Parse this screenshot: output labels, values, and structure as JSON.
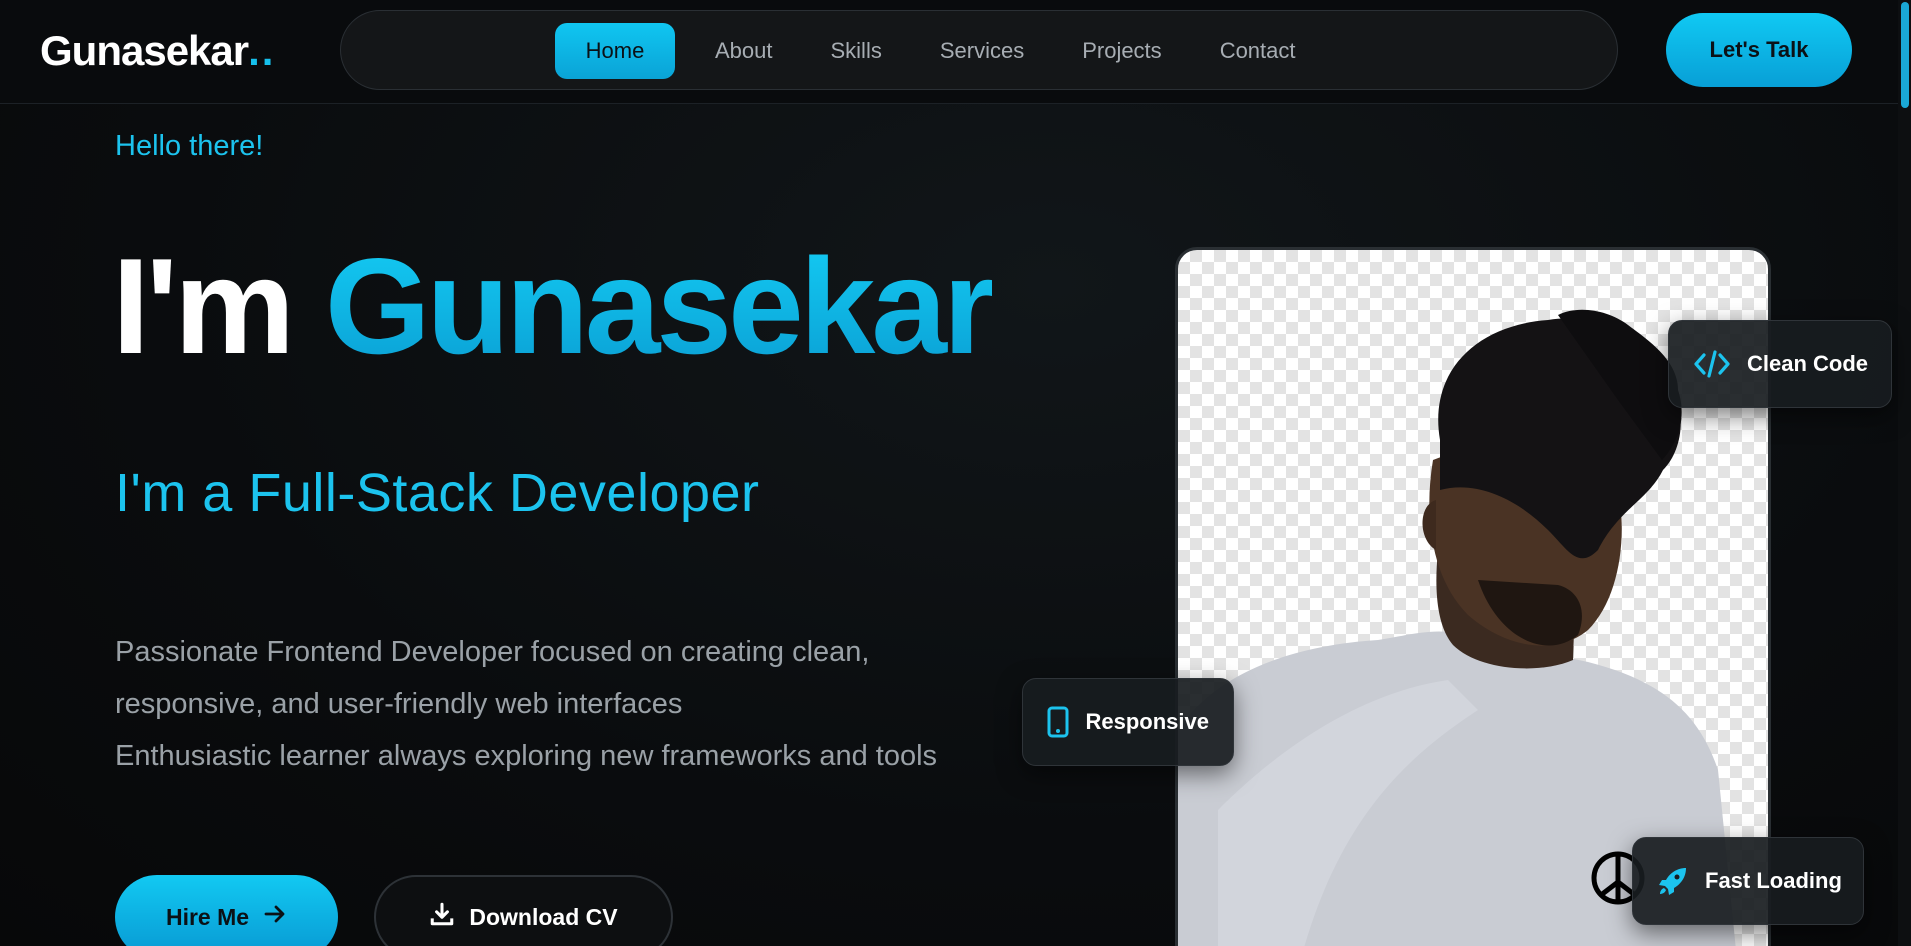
{
  "header": {
    "logo_text": "Gunasekar",
    "logo_dots": "..",
    "nav": [
      {
        "label": "Home",
        "active": true
      },
      {
        "label": "About",
        "active": false
      },
      {
        "label": "Skills",
        "active": false
      },
      {
        "label": "Services",
        "active": false
      },
      {
        "label": "Projects",
        "active": false
      },
      {
        "label": "Contact",
        "active": false
      }
    ],
    "cta_label": "Let's Talk"
  },
  "hero": {
    "greeting": "Hello there!",
    "title_prefix": "I'm",
    "title_name": "Gunasekar",
    "role": "I'm a Full-Stack Developer",
    "description_line1": "Passionate Frontend Developer focused on creating clean,",
    "description_line2": "responsive, and user-friendly web interfaces",
    "description_line3": "Enthusiastic learner always exploring new frameworks and tools",
    "hire_label": "Hire Me",
    "cv_label": "Download CV"
  },
  "badges": {
    "clean_code": "Clean Code",
    "responsive": "Responsive",
    "fast_loading": "Fast Loading"
  },
  "colors": {
    "accent": "#16c0ec",
    "accent_dark": "#0a9ed3",
    "background": "#0a0c0e",
    "muted_text": "#9aa1a7"
  },
  "icons": {
    "hire_button": "arrow-right-icon",
    "cv_button": "download-icon",
    "clean_code": "code-icon",
    "responsive": "mobile-phone-icon",
    "fast_loading": "rocket-icon"
  }
}
